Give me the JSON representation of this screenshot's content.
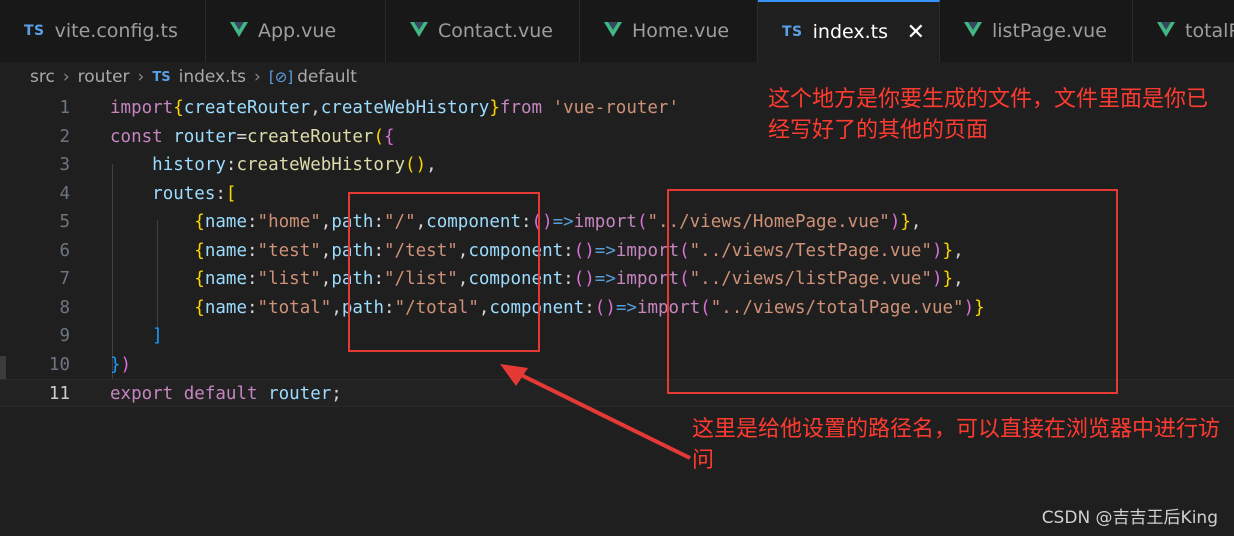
{
  "tabs": [
    {
      "label": "vite.config.ts",
      "icon": "ts-icon",
      "width": 206
    },
    {
      "label": "App.vue",
      "icon": "vue-icon",
      "width": 180
    },
    {
      "label": "Contact.vue",
      "icon": "vue-icon",
      "width": 194
    },
    {
      "label": "Home.vue",
      "icon": "vue-icon",
      "width": 178
    },
    {
      "label": "index.ts",
      "icon": "ts-icon",
      "width": 182,
      "active": true
    },
    {
      "label": "listPage.vue",
      "icon": "vue-icon",
      "width": 193
    },
    {
      "label": "totalPage.vue",
      "icon": "vue-icon",
      "width": 190
    }
  ],
  "breadcrumb": {
    "folder1": "src",
    "folder2": "router",
    "file": "index.ts",
    "symbol": "default",
    "ts_badge": "TS",
    "sym_badge": "[⊘]"
  },
  "tab_close": "✕",
  "ts_badge": "TS",
  "code": {
    "line_numbers": [
      "1",
      "2",
      "3",
      "4",
      "5",
      "6",
      "7",
      "8",
      "9",
      "10",
      "11"
    ],
    "lines": [
      "import{createRouter,createWebHistory}from 'vue-router'",
      "const router=createRouter({",
      "    history:createWebHistory(),",
      "    routes:[",
      "        {name:\"home\",path:\"/\",component:()=>import(\"../views/HomePage.vue\")},",
      "        {name:\"test\",path:\"/test\",component:()=>import(\"../views/TestPage.vue\")},",
      "        {name:\"list\",path:\"/list\",component:()=>import(\"../views/listPage.vue\")},",
      "        {name:\"total\",path:\"/total\",component:()=>import(\"../views/totalPage.vue\")}",
      "    ]",
      "})",
      "export default router;"
    ]
  },
  "annotations": {
    "top_note": "这个地方是你要生成的文件，文件里面是你已经写好了的其他的页面",
    "bottom_note": "这里是给他设置的路径名，可以直接在浏览器中进行访问"
  },
  "watermark": "CSDN @吉吉王后King",
  "colors": {
    "annotation": "#ff3b30",
    "keyword": "#c586c0",
    "string": "#ce9178",
    "variable": "#9cdcfe",
    "function": "#dcdcaa"
  }
}
